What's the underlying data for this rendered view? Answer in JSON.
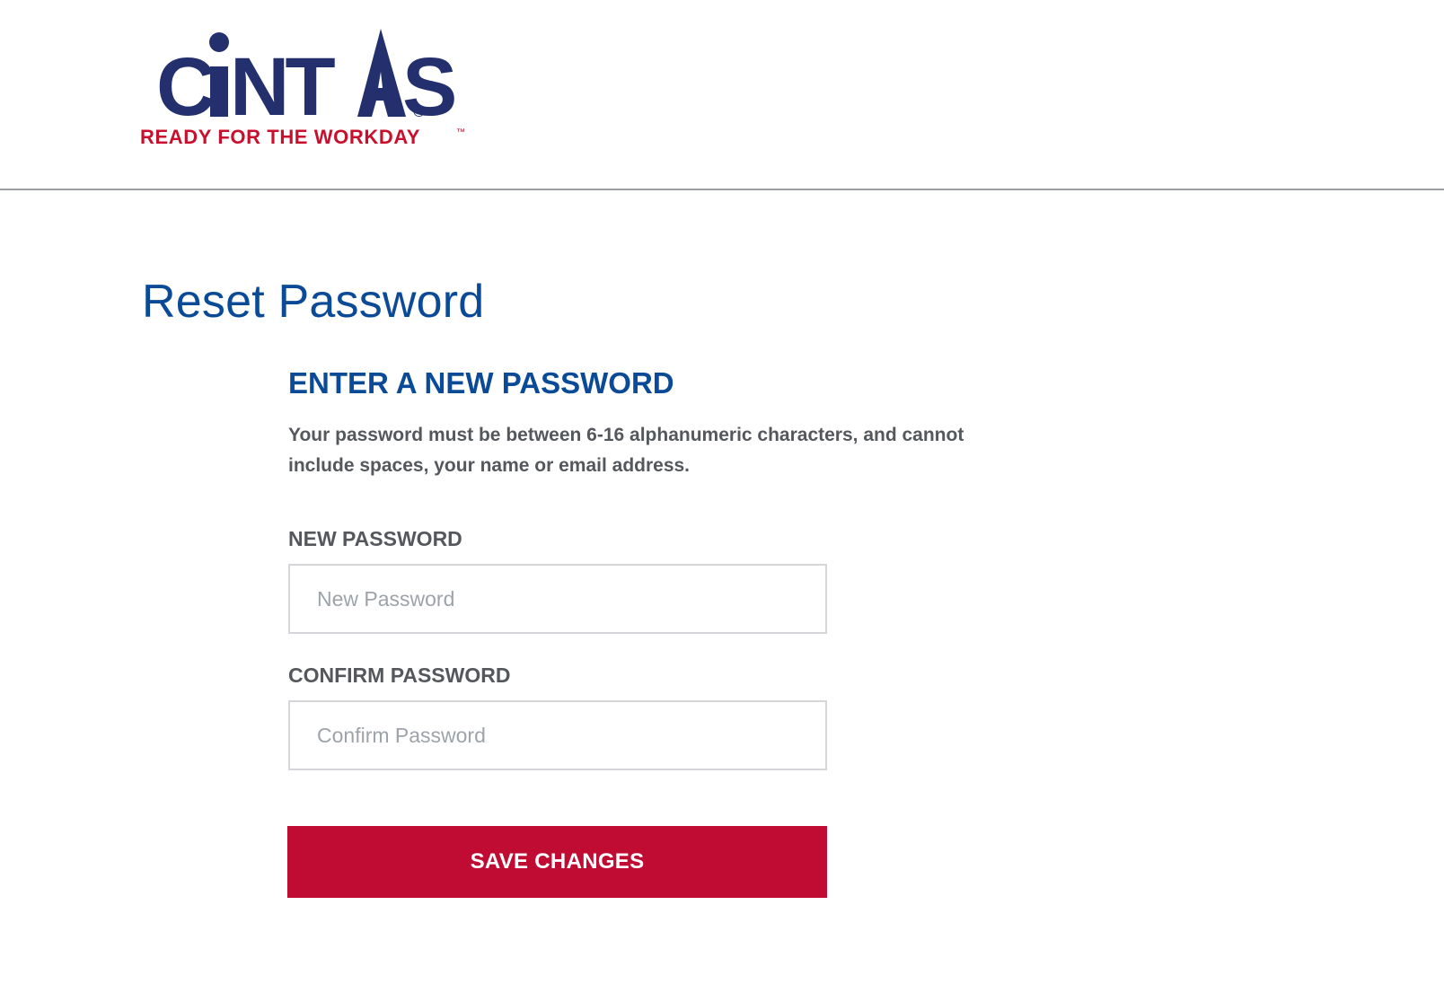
{
  "brand": {
    "logo_text": "CiNTAS",
    "registered_mark": "®",
    "tagline": "READY FOR THE WORKDAY",
    "tagline_mark": "™",
    "primary_color": "#24306e",
    "tagline_color": "#c8102e"
  },
  "page": {
    "title": "Reset Password"
  },
  "form": {
    "heading": "ENTER A NEW PASSWORD",
    "description": "Your password must be between 6-16 alphanumeric characters, and cannot include spaces, your name or email address.",
    "new_password": {
      "label": "NEW PASSWORD",
      "placeholder": "New Password",
      "value": ""
    },
    "confirm_password": {
      "label": "CONFIRM PASSWORD",
      "placeholder": "Confirm Password",
      "value": ""
    },
    "save_label": "SAVE CHANGES"
  },
  "colors": {
    "heading_blue": "#0a4a97",
    "text_gray": "#54585c",
    "button_red": "#c00c33",
    "divider": "#9a9ea3"
  }
}
